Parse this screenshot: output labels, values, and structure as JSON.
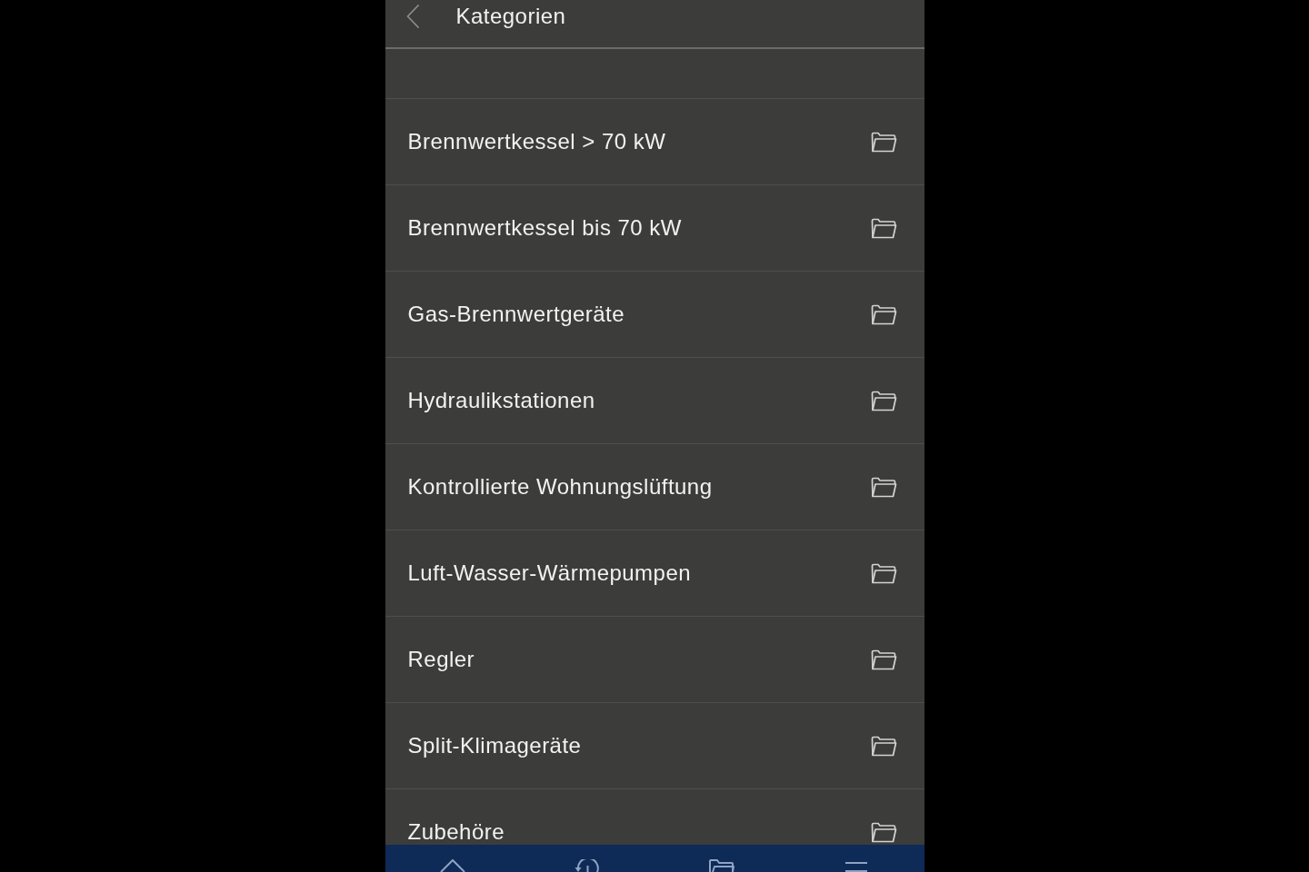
{
  "header": {
    "title": "Kategorien"
  },
  "categories": [
    {
      "label": "Brennwertkessel > 70 kW"
    },
    {
      "label": "Brennwertkessel bis 70 kW"
    },
    {
      "label": "Gas-Brennwertgeräte"
    },
    {
      "label": "Hydraulikstationen"
    },
    {
      "label": "Kontrollierte Wohnungslüftung"
    },
    {
      "label": "Luft-Wasser-Wärmepumpen"
    },
    {
      "label": "Regler"
    },
    {
      "label": "Split-Klimageräte"
    },
    {
      "label": "Zubehöre"
    }
  ]
}
